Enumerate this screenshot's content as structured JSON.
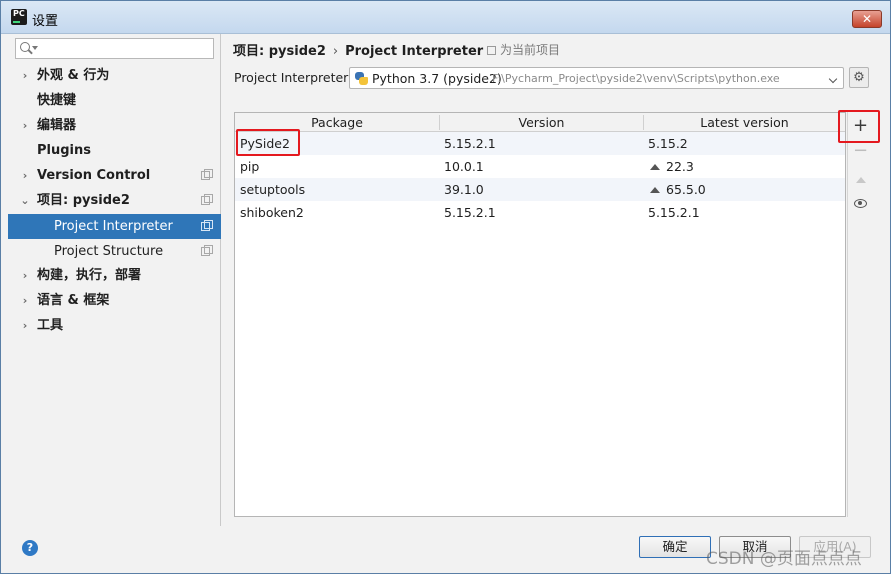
{
  "window": {
    "title": "设置",
    "app_icon": "pycharm-icon"
  },
  "sidebar": {
    "search_placeholder": "",
    "items": [
      {
        "label": "外观 & 行为",
        "expandable": true
      },
      {
        "label": "快捷键",
        "expandable": false
      },
      {
        "label": "编辑器",
        "expandable": true
      },
      {
        "label": "Plugins",
        "expandable": false
      },
      {
        "label": "Version Control",
        "expandable": true
      },
      {
        "label": "项目: pyside2",
        "expandable": true,
        "expanded": true
      },
      {
        "label": "Project Interpreter",
        "child": true,
        "selected": true
      },
      {
        "label": "Project Structure",
        "child": true
      },
      {
        "label": "构建，执行，部署",
        "expandable": true
      },
      {
        "label": "语言 & 框架",
        "expandable": true
      },
      {
        "label": "工具",
        "expandable": true
      }
    ]
  },
  "breadcrumb": {
    "project": "项目: pyside2",
    "page": "Project Interpreter"
  },
  "project_note": "为当前项目",
  "interpreter": {
    "label": "Project Interpreter:",
    "name": "Python 3.7 (pyside2)",
    "path": "F:\\Pycharm_Project\\pyside2\\venv\\Scripts\\python.exe"
  },
  "table": {
    "headers": [
      "Package",
      "Version",
      "Latest version"
    ],
    "rows": [
      {
        "package": "PySide2",
        "version": "5.15.2.1",
        "latest": "5.15.2",
        "upgrade": false
      },
      {
        "package": "pip",
        "version": "10.0.1",
        "latest": "22.3",
        "upgrade": true
      },
      {
        "package": "setuptools",
        "version": "39.1.0",
        "latest": "65.5.0",
        "upgrade": true
      },
      {
        "package": "shiboken2",
        "version": "5.15.2.1",
        "latest": "5.15.2.1",
        "upgrade": false
      }
    ]
  },
  "tools": {
    "add": "+",
    "remove": "−"
  },
  "footer": {
    "help": "?",
    "ok": "确定",
    "cancel": "取消",
    "apply": "应用(A)"
  },
  "watermark": "CSDN @页面点点点",
  "colors": {
    "selection": "#2f76b8",
    "highlight": "#e4191f"
  }
}
